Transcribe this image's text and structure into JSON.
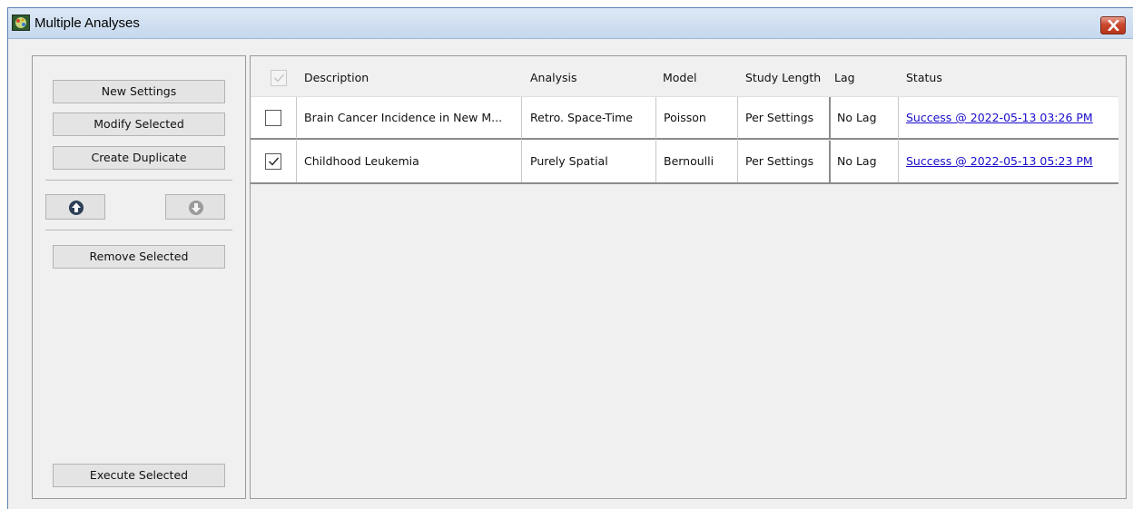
{
  "window": {
    "title": "Multiple Analyses"
  },
  "left_panel": {
    "new_settings": "New Settings",
    "modify_selected": "Modify Selected",
    "create_duplicate": "Create Duplicate",
    "move_up_icon": "arrow-up-circle-icon",
    "move_down_icon": "arrow-down-circle-icon",
    "remove_selected": "Remove Selected",
    "execute_selected": "Execute Selected"
  },
  "table": {
    "columns": [
      "Description",
      "Analysis",
      "Model",
      "Study Length",
      "Lag",
      "Status"
    ],
    "rows": [
      {
        "checked": false,
        "description": "Brain Cancer Incidence in New M...",
        "analysis": "Retro. Space-Time",
        "model": "Poisson",
        "study_length": "Per Settings",
        "lag": "No Lag",
        "status": "Success @ 2022-05-13 03:26 PM"
      },
      {
        "checked": true,
        "description": "Childhood Leukemia",
        "analysis": "Purely Spatial",
        "model": "Bernoulli",
        "study_length": "Per Settings",
        "lag": "No Lag",
        "status": "Success @ 2022-05-13 05:23 PM"
      }
    ]
  },
  "colors": {
    "link": "#1a0dcc",
    "close_button": "#c9492f",
    "titlebar": "#c6d8ee"
  }
}
